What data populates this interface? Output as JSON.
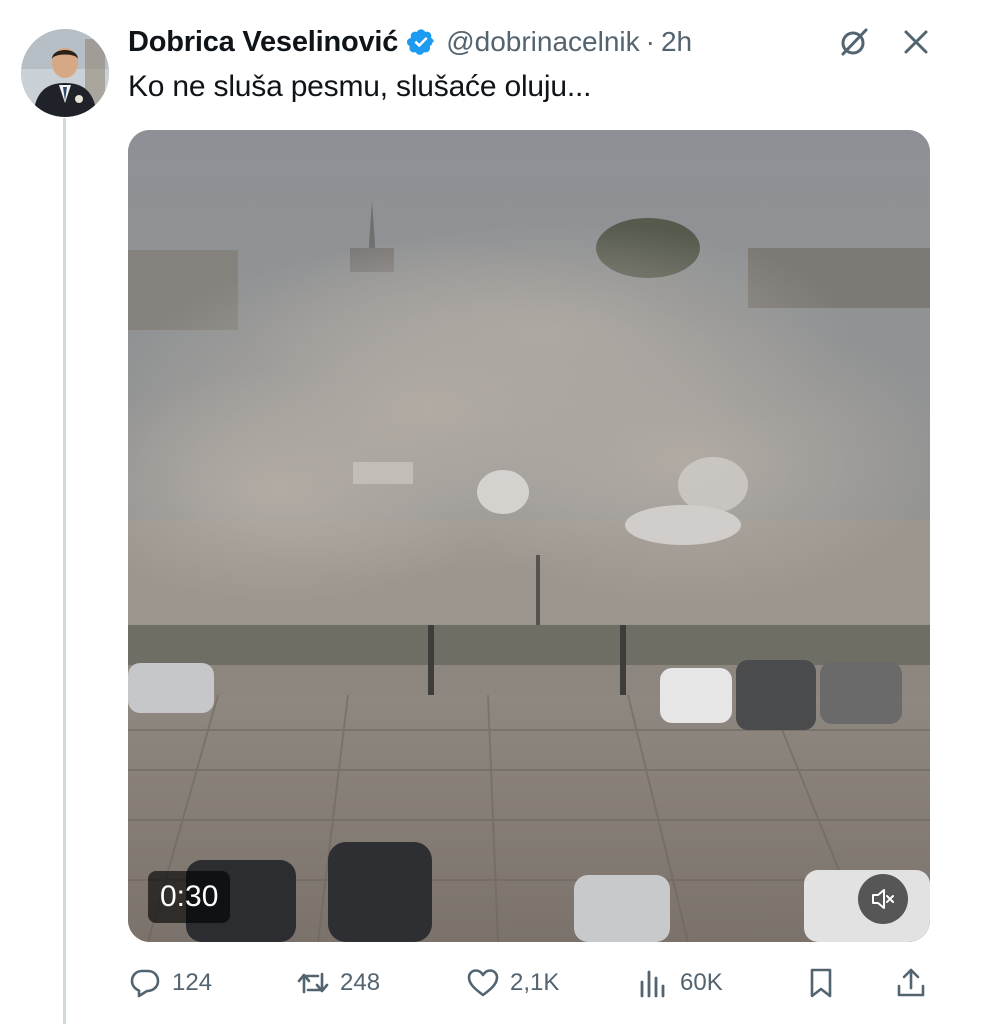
{
  "tweet": {
    "author": {
      "display_name": "Dobrica Veselinović",
      "handle": "@dobrinacelnik",
      "verified": true
    },
    "separator": "·",
    "time": "2h",
    "text": "Ko ne sluša pesmu, slušaće oluju...",
    "media": {
      "type": "video",
      "duration": "0:30",
      "muted": true
    },
    "metrics": {
      "replies": "124",
      "reposts": "248",
      "likes": "2,1K",
      "views": "60K"
    }
  },
  "icons": {
    "verified_badge": "verified-badge-icon",
    "grok": "grok-slash-icon",
    "close": "close-icon",
    "reply": "reply-bubble-icon",
    "repost": "repost-icon",
    "like": "heart-icon",
    "views": "bar-chart-icon",
    "bookmark": "bookmark-icon",
    "share": "share-upload-icon",
    "mute": "speaker-muted-icon"
  },
  "colors": {
    "verified_blue": "#1d9bf0",
    "text_primary": "#0f1419",
    "text_secondary": "#536471",
    "thread_line": "#cfd9de"
  }
}
